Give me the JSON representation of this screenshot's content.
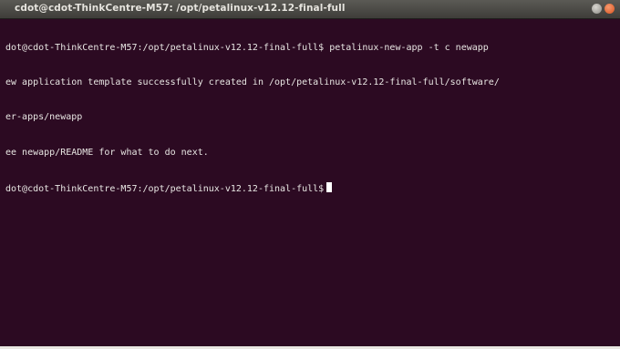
{
  "window": {
    "title": "cdot@cdot-ThinkCentre-M57: /opt/petalinux-v12.12-final-full"
  },
  "terminal": {
    "lines": [
      "dot@cdot-ThinkCentre-M57:/opt/petalinux-v12.12-final-full$ petalinux-new-app -t c newapp",
      "ew application template successfully created in /opt/petalinux-v12.12-final-full/software/",
      "er-apps/newapp",
      "ee newapp/README for what to do next.",
      "dot@cdot-ThinkCentre-M57:/opt/petalinux-v12.12-final-full$"
    ]
  },
  "colors": {
    "terminal_background": "#2c0a22",
    "titlebar": "#4a4945",
    "close_button": "#e0602a"
  },
  "icons": [
    "minimize-icon",
    "close-icon"
  ]
}
